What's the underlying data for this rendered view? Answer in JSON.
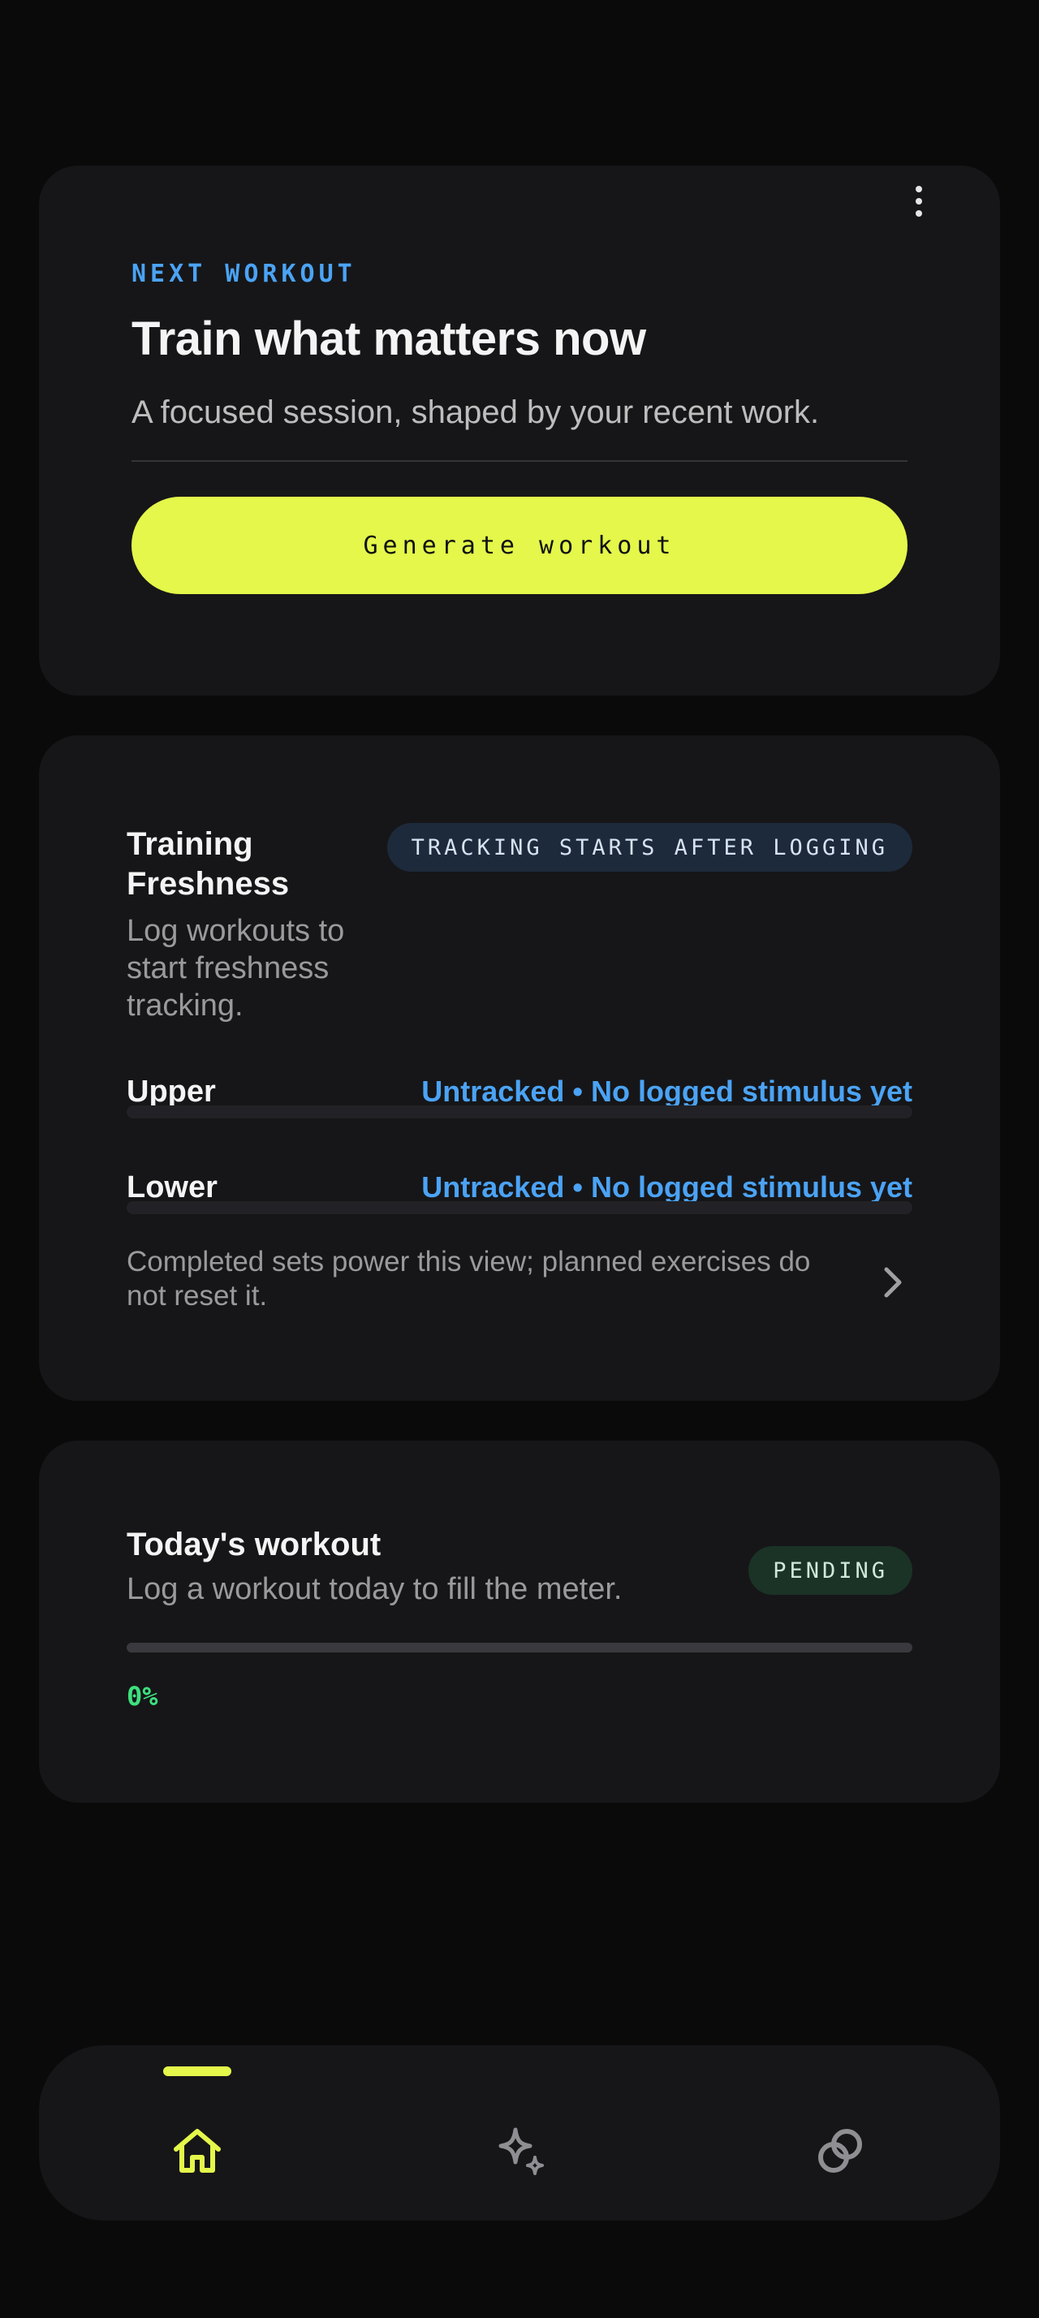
{
  "colors": {
    "background": "#0a0a0b",
    "card": "#161618",
    "accent_lime": "#e4f74a",
    "accent_blue": "#4ba3f5",
    "accent_green": "#3ee07f"
  },
  "next_workout": {
    "eyebrow": "NEXT WORKOUT",
    "title": "Train what matters now",
    "subtitle": "A focused session, shaped by your recent work.",
    "button_label": "Generate workout",
    "menu_icon": "more-vertical-icon"
  },
  "freshness": {
    "title": "Training Freshness",
    "subtitle": "Log workouts to start freshness tracking.",
    "badge": "TRACKING STARTS AFTER LOGGING",
    "zones": [
      {
        "name": "Upper",
        "status": "Untracked • No logged stimulus yet"
      },
      {
        "name": "Lower",
        "status": "Untracked • No logged stimulus yet"
      }
    ],
    "note": "Completed sets power this view; planned exercises do not reset it.",
    "chevron_icon": "chevron-right-icon"
  },
  "today": {
    "title": "Today's workout",
    "subtitle": "Log a workout today to fill the meter.",
    "badge": "PENDING",
    "progress_percent": 0,
    "progress_label": "0%"
  },
  "nav": {
    "items": [
      {
        "icon": "home-icon",
        "active": true
      },
      {
        "icon": "sparkle-icon",
        "active": false
      },
      {
        "icon": "link-circles-icon",
        "active": false
      }
    ]
  }
}
